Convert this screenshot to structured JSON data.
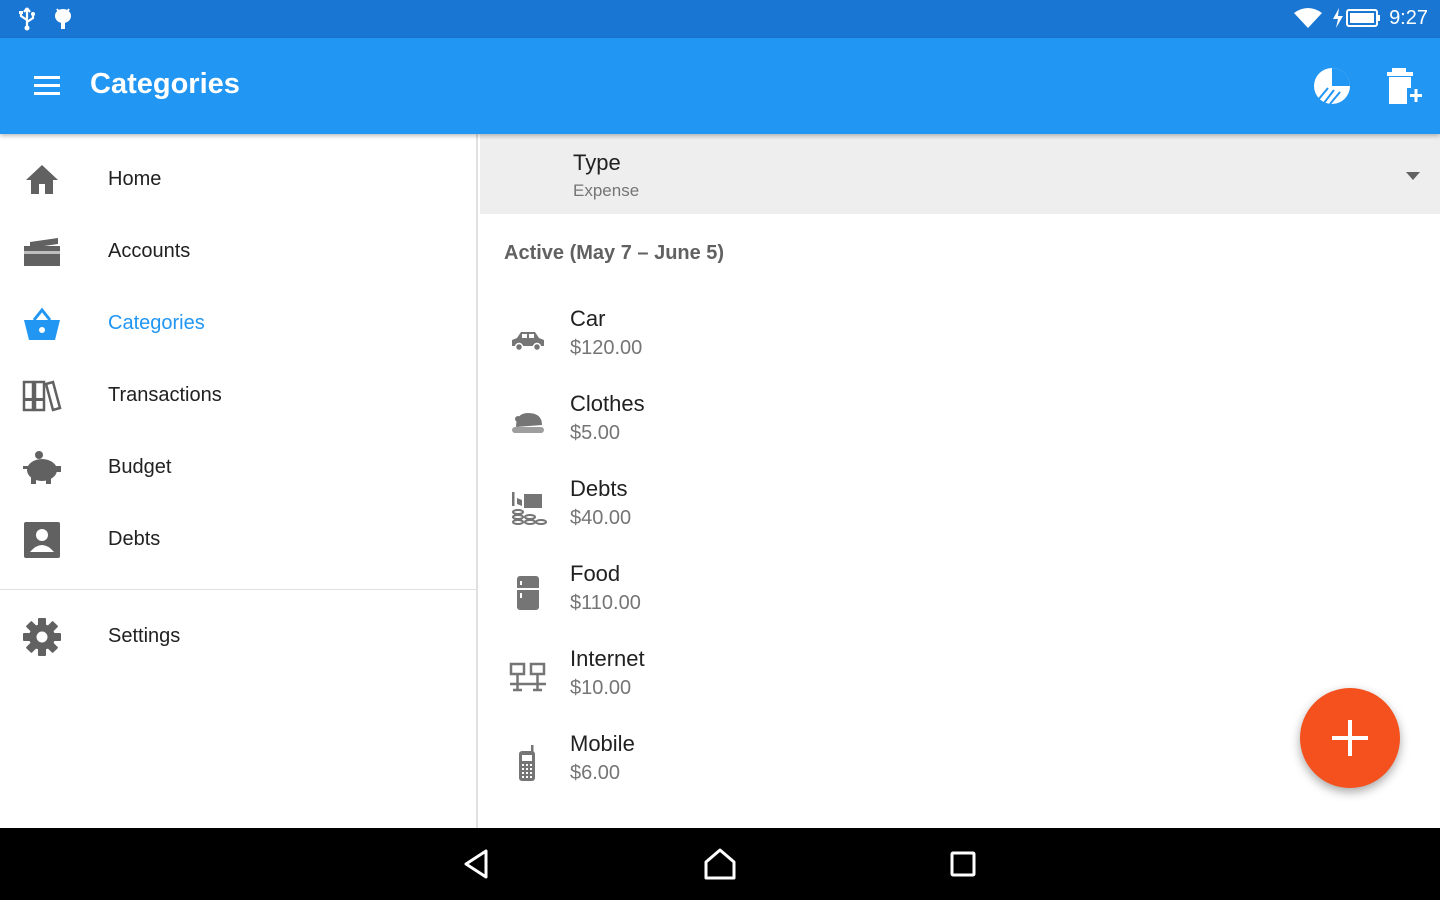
{
  "status_bar": {
    "left_icons": [
      "usb-icon",
      "android-debug-icon"
    ],
    "right_icons": [
      "wifi-icon",
      "battery-charging-icon"
    ],
    "time": "9:27"
  },
  "app_bar": {
    "title": "Categories",
    "icons": [
      "menu-icon",
      "pie-chart-icon",
      "delete-add-icon"
    ]
  },
  "drawer": {
    "items": [
      {
        "label": "Home",
        "icon": "home-icon"
      },
      {
        "label": "Accounts",
        "icon": "cards-icon"
      },
      {
        "label": "Categories",
        "icon": "basket-icon"
      },
      {
        "label": "Transactions",
        "icon": "binders-icon"
      },
      {
        "label": "Budget",
        "icon": "piggy-bank-icon"
      },
      {
        "label": "Debts",
        "icon": "contact-icon"
      }
    ],
    "settings": {
      "label": "Settings",
      "icon": "gear-icon"
    },
    "active_color": "#2196f3"
  },
  "type_selector": {
    "label": "Type",
    "value": "Expense"
  },
  "section_header": "Active (May 7 – June 5)",
  "categories": [
    {
      "name": "Car",
      "amount": "$120.00",
      "icon": "car-icon"
    },
    {
      "name": "Clothes",
      "amount": "$5.00",
      "icon": "hat-icon"
    },
    {
      "name": "Debts",
      "amount": "$40.00",
      "icon": "coins-icon"
    },
    {
      "name": "Food",
      "amount": "$110.00",
      "icon": "fridge-icon"
    },
    {
      "name": "Internet",
      "amount": "$10.00",
      "icon": "network-icon"
    },
    {
      "name": "Mobile",
      "amount": "$6.00",
      "icon": "phone-icon"
    }
  ],
  "fab": {
    "icon": "plus-icon",
    "color": "#f4511e"
  },
  "colors": {
    "status_bar": "#1976d2",
    "app_bar": "#2196f3",
    "accent": "#2196f3"
  }
}
